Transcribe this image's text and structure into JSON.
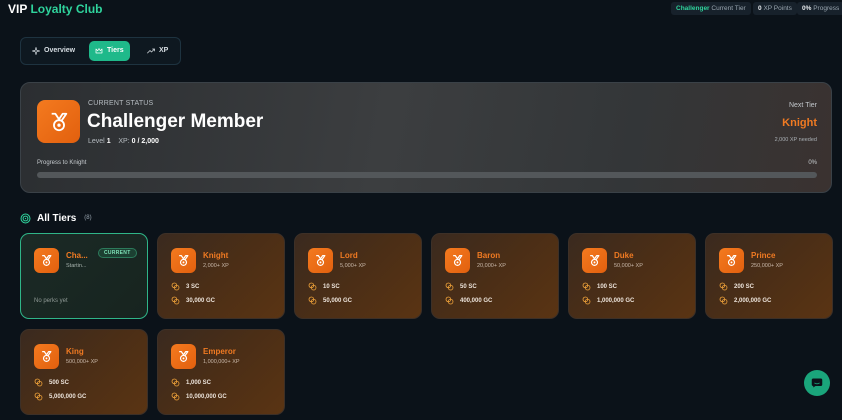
{
  "app": {
    "title_white": "VIP",
    "title_green": "Loyalty Club"
  },
  "header_stats": [
    {
      "value": "Challenger",
      "label": "Current Tier"
    },
    {
      "value": "0",
      "label": "XP Points"
    },
    {
      "value": "0%",
      "label": "Progress"
    }
  ],
  "tabs": [
    {
      "label": "Overview",
      "icon": "sparkle-icon",
      "active": false
    },
    {
      "label": "Tiers",
      "icon": "crown-icon",
      "active": true
    },
    {
      "label": "XP",
      "icon": "trend-up-icon",
      "active": false
    }
  ],
  "status": {
    "label": "CURRENT STATUS",
    "name": "Challenger Member",
    "level_label": "Level",
    "level_value": "1",
    "xp_label": "XP:",
    "xp_value": "0 / 2,000",
    "next_label": "Next Tier",
    "next_name": "Knight",
    "next_needed": "2,000 XP needed",
    "progress_label": "Progress to Knight",
    "progress_text": "0%",
    "progress_fraction": 0
  },
  "all_tiers": {
    "title": "All Tiers",
    "count": "(8)"
  },
  "current_badge": "CURRENT",
  "no_perks_text": "No perks yet",
  "colors": {
    "accent": "#2fd39c",
    "tier_orange": "#f07a22"
  },
  "tiers": [
    {
      "name": "Cha...",
      "xp": "Startin...",
      "current": true,
      "sc": "",
      "gc": ""
    },
    {
      "name": "Knight",
      "xp": "2,000+ XP",
      "current": false,
      "sc": "3 SC",
      "gc": "30,000 GC"
    },
    {
      "name": "Lord",
      "xp": "5,000+ XP",
      "current": false,
      "sc": "10 SC",
      "gc": "50,000 GC"
    },
    {
      "name": "Baron",
      "xp": "20,000+ XP",
      "current": false,
      "sc": "50 SC",
      "gc": "400,000 GC"
    },
    {
      "name": "Duke",
      "xp": "50,000+ XP",
      "current": false,
      "sc": "100 SC",
      "gc": "1,000,000 GC"
    },
    {
      "name": "Prince",
      "xp": "250,000+ XP",
      "current": false,
      "sc": "200 SC",
      "gc": "2,000,000 GC"
    },
    {
      "name": "King",
      "xp": "500,000+ XP",
      "current": false,
      "sc": "500 SC",
      "gc": "5,000,000 GC"
    },
    {
      "name": "Emperor",
      "xp": "1,000,000+ XP",
      "current": false,
      "sc": "1,000 SC",
      "gc": "10,000,000 GC"
    }
  ]
}
